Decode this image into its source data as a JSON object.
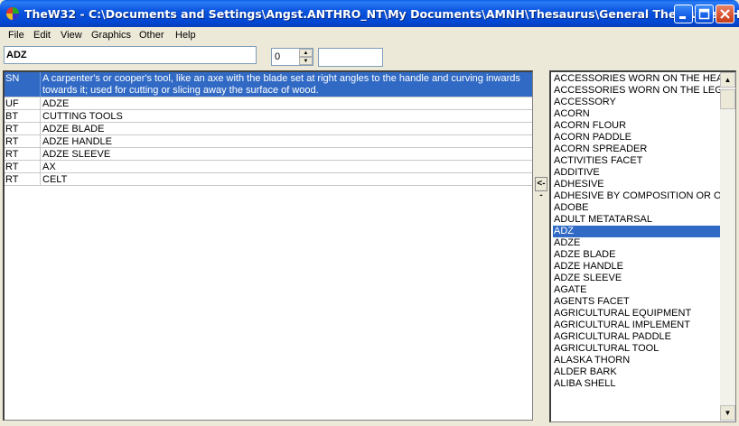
{
  "window": {
    "title": "TheW32 - C:\\Documents and Settings\\Angst.ANTHRO_NT\\My Documents\\AMNH\\Thesaurus\\General Thesaurus.THE",
    "app_icon": "thew32-app-icon",
    "controls": [
      "minimize-icon",
      "maximize-icon",
      "close-icon"
    ]
  },
  "menu": [
    "File",
    "Edit",
    "View",
    "Graphics",
    "Other",
    "Help"
  ],
  "toolbar": {
    "term": "ADZ",
    "level_value": "0",
    "aux_value": ""
  },
  "relations": [
    {
      "code": "SN",
      "value": "A carpenter's or cooper's tool, like an axe with the blade set at right angles to the handle and curving inwards towards it; used for cutting or slicing away the surface of wood.",
      "selected": true
    },
    {
      "code": "UF",
      "value": "ADZE",
      "selected": false
    },
    {
      "code": "BT",
      "value": "CUTTING TOOLS",
      "selected": false
    },
    {
      "code": "RT",
      "value": "ADZE BLADE",
      "selected": false
    },
    {
      "code": "RT",
      "value": "ADZE HANDLE",
      "selected": false
    },
    {
      "code": "RT",
      "value": "ADZE SLEEVE",
      "selected": false
    },
    {
      "code": "RT",
      "value": "AX",
      "selected": false
    },
    {
      "code": "RT",
      "value": "CELT",
      "selected": false
    }
  ],
  "transfer_button": "<--",
  "term_list": {
    "items": [
      "ACCESSORIES WORN ON THE HEAD",
      "ACCESSORIES WORN ON THE LEGS",
      "ACCESSORY",
      "ACORN",
      "ACORN FLOUR",
      "ACORN PADDLE",
      "ACORN SPREADER",
      "ACTIVITIES FACET",
      "ADDITIVE",
      "ADHESIVE",
      "ADHESIVE BY COMPOSITION OR ORIGIN",
      "ADOBE",
      "ADULT METATARSAL",
      "ADZ",
      "ADZE",
      "ADZE BLADE",
      "ADZE HANDLE",
      "ADZE SLEEVE",
      "AGATE",
      "AGENTS FACET",
      "AGRICULTURAL EQUIPMENT",
      "AGRICULTURAL IMPLEMENT",
      "AGRICULTURAL PADDLE",
      "AGRICULTURAL TOOL",
      "ALASKA THORN",
      "ALDER BARK",
      "ALIBA SHELL"
    ],
    "selected_index": 13
  }
}
